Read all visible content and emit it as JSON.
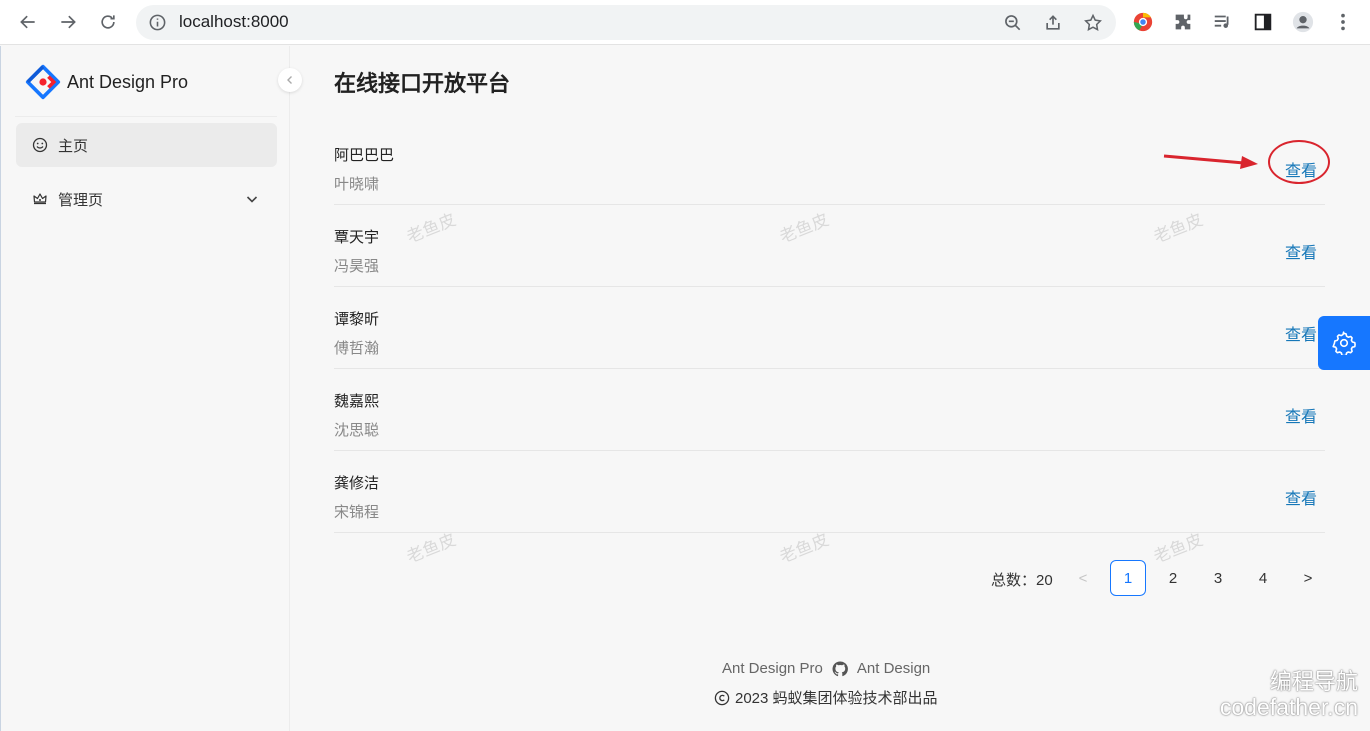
{
  "browser": {
    "url": "localhost:8000"
  },
  "sidebar": {
    "brand": "Ant Design Pro",
    "items": [
      {
        "label": "主页",
        "icon": "smile-icon",
        "active": true
      },
      {
        "label": "管理页",
        "icon": "crown-icon",
        "active": false
      }
    ]
  },
  "main": {
    "title": "在线接口开放平台",
    "list": [
      {
        "title": "阿巴巴巴",
        "description": "叶晓啸",
        "action": "查看"
      },
      {
        "title": "覃天宇",
        "description": "冯昊强",
        "action": "查看"
      },
      {
        "title": "谭黎昕",
        "description": "傅哲瀚",
        "action": "查看"
      },
      {
        "title": "魏嘉熙",
        "description": "沈思聪",
        "action": "查看"
      },
      {
        "title": "龚修洁",
        "description": "宋锦程",
        "action": "查看"
      }
    ],
    "watermark": "老鱼皮"
  },
  "pagination": {
    "total_label": "总数：20",
    "pages": [
      "1",
      "2",
      "3",
      "4"
    ],
    "current": "1",
    "prev": "<",
    "next": ">"
  },
  "footer": {
    "link_left": "Ant Design Pro",
    "link_right": "Ant Design",
    "copyright": "2023 蚂蚁集团体验技术部出品"
  },
  "site_mark": {
    "line1": "编程导航",
    "line2": "codefather.cn"
  },
  "colors": {
    "primary": "#1677ff",
    "link": "#1677b8",
    "annotation": "#d9252e"
  }
}
